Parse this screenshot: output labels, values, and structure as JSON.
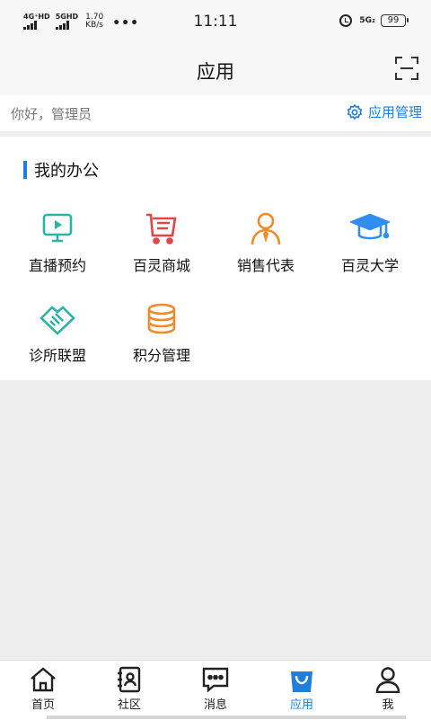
{
  "status_bar": {
    "net1": "4G⁺HD",
    "net2": "5GHD",
    "speed_value": "1.70",
    "speed_unit": "KB/s",
    "more": "•••",
    "time": "11:11",
    "sg_label": "5G₂",
    "battery": "99"
  },
  "header": {
    "title": "应用"
  },
  "greeting": {
    "text": "你好，管理员",
    "manage_label": "应用管理"
  },
  "section": {
    "title": "我的办公"
  },
  "apps": [
    {
      "label": "直播预约",
      "icon": "tv-play-icon",
      "color": "#2bb3a3"
    },
    {
      "label": "百灵商城",
      "icon": "shopping-cart-icon",
      "color": "#e04646"
    },
    {
      "label": "销售代表",
      "icon": "sales-rep-icon",
      "color": "#f08a2a"
    },
    {
      "label": "百灵大学",
      "icon": "graduation-cap-icon",
      "color": "#2f8ef0"
    },
    {
      "label": "诊所联盟",
      "icon": "handshake-icon",
      "color": "#2bb3a3"
    },
    {
      "label": "积分管理",
      "icon": "coins-icon",
      "color": "#f08a2a"
    }
  ],
  "tabs": [
    {
      "label": "首页",
      "icon": "home-icon"
    },
    {
      "label": "社区",
      "icon": "contacts-book-icon"
    },
    {
      "label": "消息",
      "icon": "message-icon"
    },
    {
      "label": "应用",
      "icon": "app-bag-icon",
      "active": true
    },
    {
      "label": "我",
      "icon": "person-icon"
    }
  ],
  "colors": {
    "accent": "#1f7fe0"
  }
}
